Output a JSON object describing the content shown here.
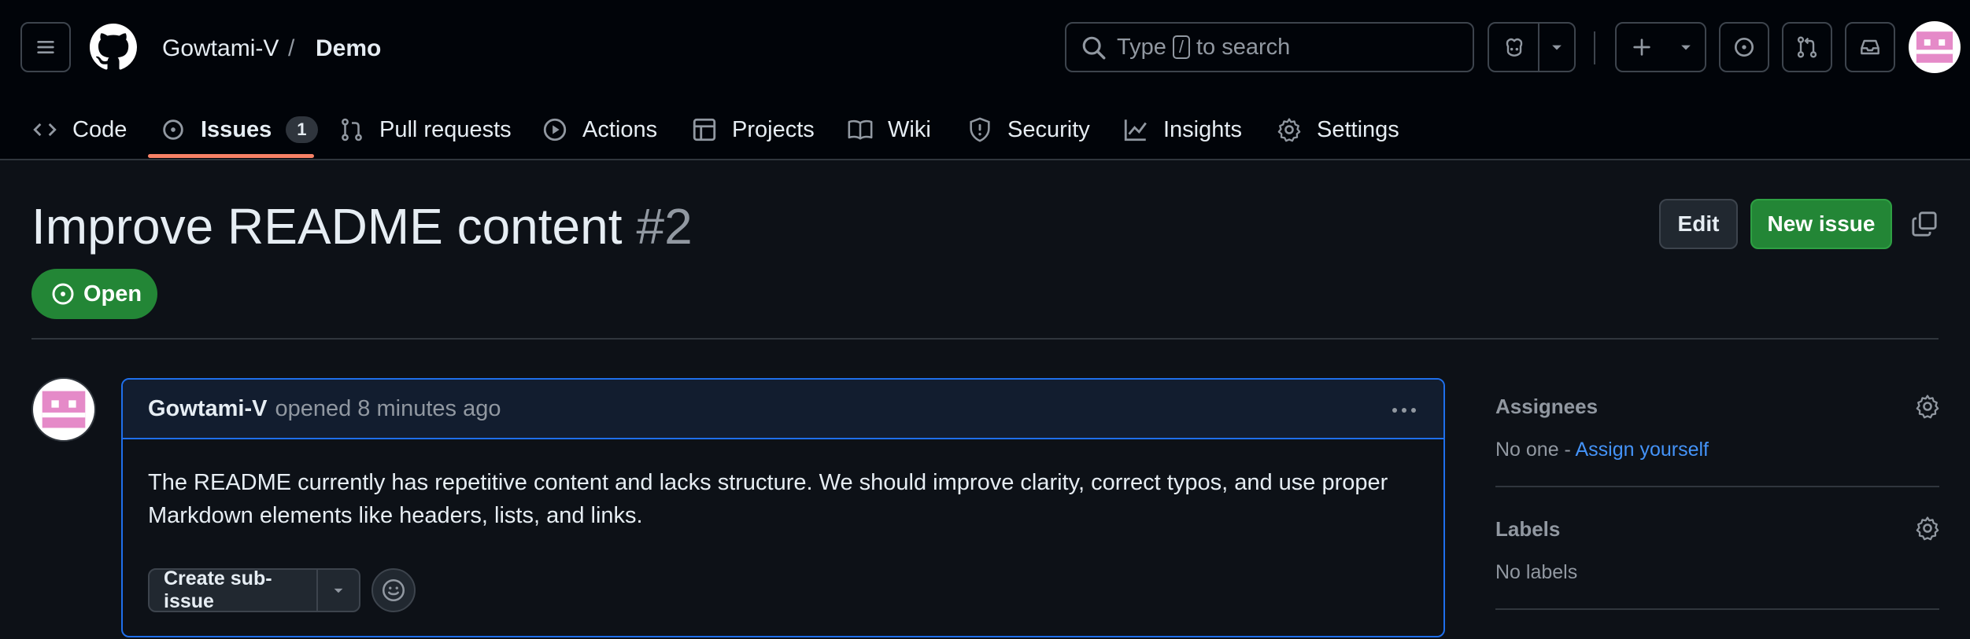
{
  "header": {
    "owner": "Gowtami-V",
    "separator": "/",
    "repo": "Demo",
    "search": {
      "prefix": "Type",
      "key": "/",
      "suffix": "to search"
    }
  },
  "tabs": [
    {
      "label": "Code",
      "icon": "code-icon"
    },
    {
      "label": "Issues",
      "icon": "issue-icon",
      "count": "1"
    },
    {
      "label": "Pull requests",
      "icon": "pull-request-icon"
    },
    {
      "label": "Actions",
      "icon": "play-icon"
    },
    {
      "label": "Projects",
      "icon": "table-icon"
    },
    {
      "label": "Wiki",
      "icon": "book-icon"
    },
    {
      "label": "Security",
      "icon": "shield-icon"
    },
    {
      "label": "Insights",
      "icon": "graph-icon"
    },
    {
      "label": "Settings",
      "icon": "gear-icon"
    }
  ],
  "issue": {
    "title": "Improve README content",
    "number": "#2",
    "state": "Open",
    "edit_label": "Edit",
    "new_issue_label": "New issue"
  },
  "comment": {
    "author": "Gowtami-V",
    "meta": "opened 8 minutes ago",
    "body_line1": "The README currently has repetitive content and lacks structure. We should improve clarity, correct typos, and use proper",
    "body_line2": "Markdown elements like headers, lists, and links.",
    "sub_issue_label": "Create sub-issue"
  },
  "sidebar": {
    "assignees_label": "Assignees",
    "assignees_value": "No one -",
    "assign_yourself": "Assign yourself",
    "labels_label": "Labels",
    "labels_value": "No labels"
  },
  "colors": {
    "accent_green": "#238636",
    "link_blue": "#4493f8",
    "tab_underline": "#f78166",
    "avatar_pink": "#e58ac8"
  }
}
